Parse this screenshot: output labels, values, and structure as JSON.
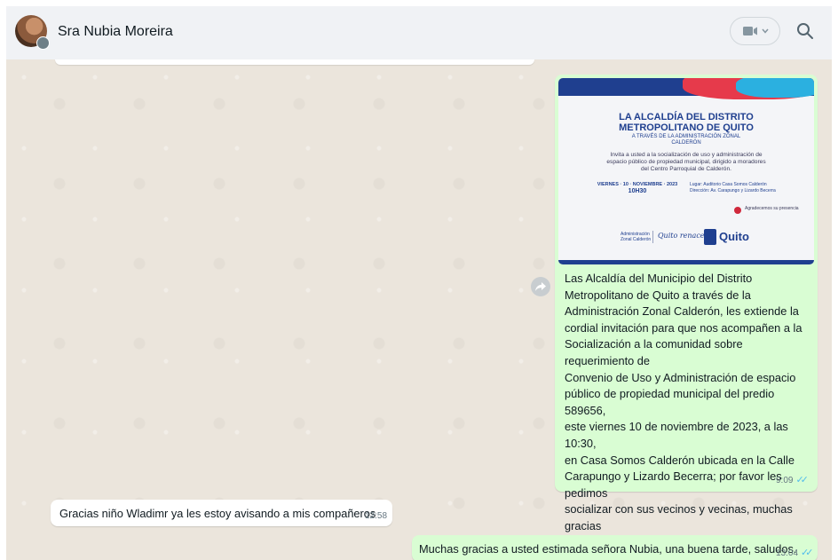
{
  "header": {
    "contact_name": "Sra Nubia Moreira",
    "video_icon": "video-camera-icon",
    "search_icon": "search-icon"
  },
  "colors": {
    "header_bg": "#f0f2f5",
    "chat_bg": "#ebe5dc",
    "outgoing_bubble": "#d9fdd3",
    "incoming_bubble": "#ffffff",
    "read_ticks": "#53bdeb"
  },
  "messages": [
    {
      "direction": "outgoing",
      "type": "image",
      "flyer": {
        "title_line1": "LA ALCALDÍA DEL DISTRITO",
        "title_line2": "METROPOLITANO DE QUITO",
        "subtitle_line1": "A TRAVÉS DE LA ADMINISTRACIÓN ZONAL",
        "subtitle_line2": "CALDERÓN",
        "body_line1": "Invita a usted a la socialización de uso y administración de",
        "body_line2": "espacio público de propiedad municipal, dirigido a moradores",
        "body_line3": "del Centro Parroquial de Calderón.",
        "when_line1": "VIERNES · 10 · NOVIEMBRE · 2023",
        "when_line2": "10H30",
        "where_line1": "Lugar: Auditorio Casa Somos Calderón",
        "where_line2": "Dirección: Av. Carapungo y Lizardo Becerra",
        "thanks": "Agradecemos su presencia",
        "logo_adm_line1": "Administración",
        "logo_adm_line2": "Zonal Calderón",
        "logo_renace": "Quito renace",
        "logo_quito": "Quito"
      },
      "caption": "Las Alcaldía del  Municipio del Distrito\nMetropolitano de Quito a través de la\nAdministración Zonal Calderón, les extiende la\ncordial invitación para que nos acompañen a la\nSocialización a la comunidad sobre requerimiento de\nConvenio de Uso y Administración de espacio\npúblico de propiedad municipal del predio 589656,\neste viernes 10 de noviembre de 2023, a las 10:30,\nen Casa Somos Calderón ubicada en la Calle\nCarapungo y Lizardo Becerra; por favor les pedimos\nsocializar con sus vecinos y vecinas, muchas gracias\npor su atención y gentileza, que tengan un buen\ndía, saludos.",
      "time": "9:09",
      "status_icon": "double-check-read-icon"
    },
    {
      "direction": "incoming",
      "type": "text",
      "text": "Gracias  niño Wladimr ya les estoy avisando  a mis compañeros",
      "time": "12:58"
    },
    {
      "direction": "outgoing",
      "type": "text",
      "text": "Muchas gracias a usted estimada señora Nubia, una buena tarde, saludos.",
      "time": "13:04",
      "status_icon": "double-check-read-icon"
    }
  ],
  "forward_icon": "forward-arrow-icon"
}
